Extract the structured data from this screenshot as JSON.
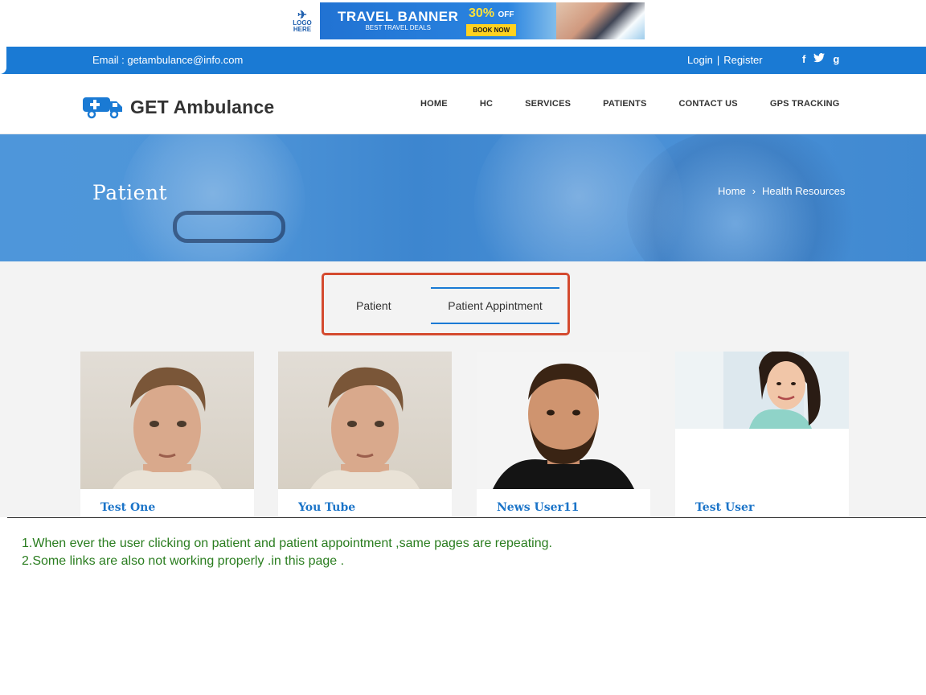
{
  "ad": {
    "title": "TRAVEL BANNER",
    "subtitle": "BEST TRAVEL DEALS",
    "offer": "30%",
    "offer_suffix": "OFF",
    "cta": "BOOK NOW",
    "logo_line1": "LOGO",
    "logo_line2": "HERE"
  },
  "topbar": {
    "email_label": "Email : getambulance@info.com",
    "login": "Login",
    "separator": "|",
    "register": "Register",
    "social": [
      "f",
      "t",
      "g"
    ]
  },
  "header": {
    "brand": "GET Ambulance",
    "nav": [
      "HOME",
      "HC",
      "SERVICES",
      "PATIENTS",
      "CONTACT US",
      "GPS TRACKING"
    ]
  },
  "hero": {
    "title": "Patient",
    "breadcrumb_home": "Home",
    "breadcrumb_current": "Health Resources"
  },
  "tabs": {
    "tab1": "Patient",
    "tab2": "Patient Appintment",
    "active": "Patient Appintment"
  },
  "cards": [
    {
      "name": "Test One"
    },
    {
      "name": "You Tube"
    },
    {
      "name": "News User11"
    },
    {
      "name": "Test User"
    }
  ],
  "notes": [
    "1.When ever the user clicking on patient and patient appointment ,same pages are repeating.",
    "2.Some links are also not working properly .in this page ."
  ],
  "colors": {
    "brand_blue": "#1a7ad4",
    "highlight_red": "#d44a2f",
    "note_green": "#2a7d1f",
    "card_name_blue": "#1b74c8"
  }
}
